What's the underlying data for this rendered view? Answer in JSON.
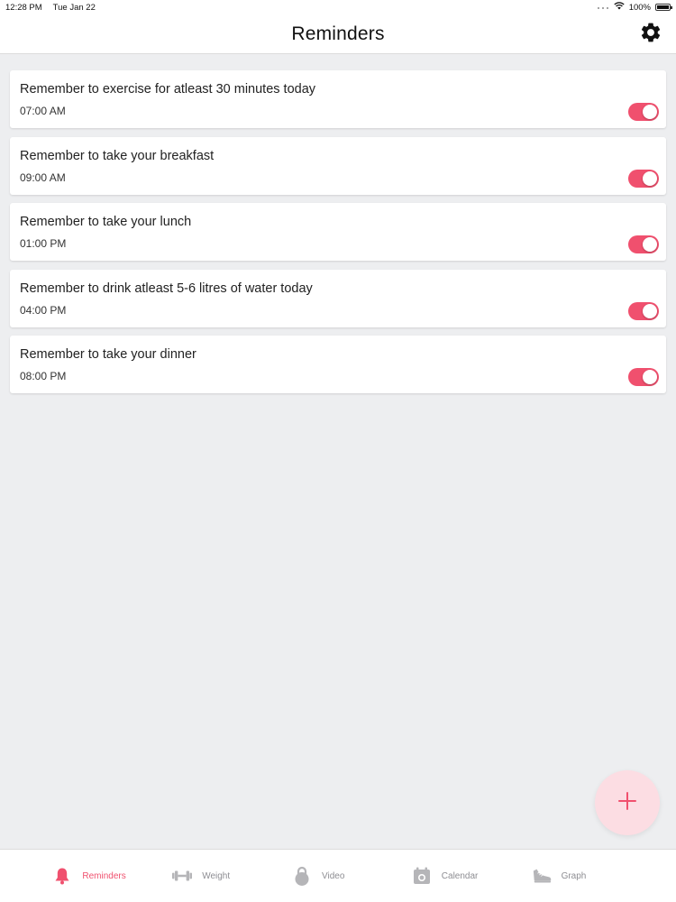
{
  "status_bar": {
    "time": "12:28 PM",
    "date": "Tue Jan 22",
    "battery": "100%"
  },
  "header": {
    "title": "Reminders",
    "settings_icon": "gear-icon"
  },
  "reminders": [
    {
      "title": "Remember to exercise for atleast 30 minutes today",
      "time": "07:00 AM",
      "enabled": true
    },
    {
      "title": "Remember to take your breakfast",
      "time": "09:00 AM",
      "enabled": true
    },
    {
      "title": "Remember to take your lunch",
      "time": "01:00 PM",
      "enabled": true
    },
    {
      "title": "Remember to drink atleast 5-6 litres of water today",
      "time": "04:00 PM",
      "enabled": true
    },
    {
      "title": "Remember to take your dinner",
      "time": "08:00 PM",
      "enabled": true
    }
  ],
  "fab": {
    "icon": "plus-icon"
  },
  "tabs": [
    {
      "label": "Reminders",
      "icon": "bell-icon",
      "active": true
    },
    {
      "label": "Weight",
      "icon": "dumbbell-icon",
      "active": false
    },
    {
      "label": "Video",
      "icon": "lock-icon",
      "active": false
    },
    {
      "label": "Calendar",
      "icon": "calendar-icon",
      "active": false
    },
    {
      "label": "Graph",
      "icon": "shoe-icon",
      "active": false
    }
  ],
  "colors": {
    "accent": "#f0506e",
    "fab_background": "#fcdde3",
    "background": "#edeef0",
    "inactive_tab": "#8e8e93"
  }
}
